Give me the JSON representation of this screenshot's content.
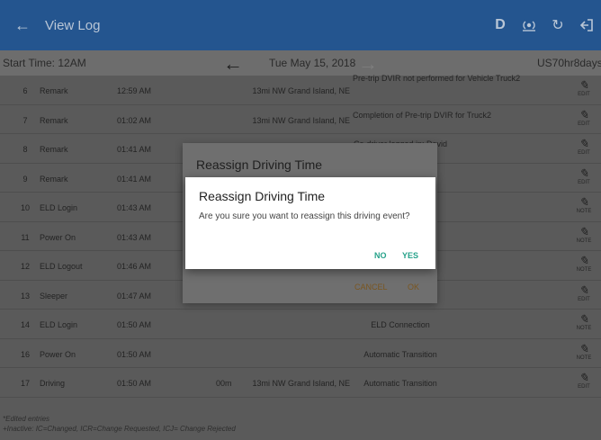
{
  "appbar": {
    "title": "View Log",
    "driver_letter": "D",
    "back_icon": "arrow-left-icon",
    "refresh_icon": "refresh-icon",
    "exit_icon": "logout-icon",
    "connection_icon": "eld-connection-icon"
  },
  "subbar": {
    "start_time": "Start Time: 12AM",
    "date": "Tue May 15, 2018",
    "ruleset": "US70hr8days"
  },
  "rows": [
    {
      "num": "6",
      "type": "Remark",
      "time": "12:59 AM",
      "dist": "",
      "location": "13mi NW Grand Island, NE",
      "note": "Pre-trip DVIR not performed for Vehicle Truck2",
      "action": "EDIT"
    },
    {
      "num": "7",
      "type": "Remark",
      "time": "01:02 AM",
      "dist": "",
      "location": "13mi NW Grand Island, NE",
      "note": "Completion of Pre-trip DVIR for Truck2",
      "action": "EDIT"
    },
    {
      "num": "8",
      "type": "Remark",
      "time": "01:41 AM",
      "dist": "",
      "location": "",
      "note": "Co-driver logged in: David",
      "action": "EDIT"
    },
    {
      "num": "9",
      "type": "Remark",
      "time": "01:41 AM",
      "dist": "",
      "location": "",
      "note": "",
      "action": "EDIT"
    },
    {
      "num": "10",
      "type": "ELD Login",
      "time": "01:43 AM",
      "dist": "",
      "location": "",
      "note": "",
      "action": "NOTE"
    },
    {
      "num": "11",
      "type": "Power On",
      "time": "01:43 AM",
      "dist": "",
      "location": "",
      "note": "",
      "action": "NOTE"
    },
    {
      "num": "12",
      "type": "ELD Logout",
      "time": "01:46 AM",
      "dist": "",
      "location": "",
      "note": "",
      "action": "NOTE"
    },
    {
      "num": "13",
      "type": "Sleeper",
      "time": "01:47 AM",
      "dist": "",
      "location": "",
      "note": "",
      "action": "EDIT"
    },
    {
      "num": "14",
      "type": "ELD Login",
      "time": "01:50 AM",
      "dist": "",
      "location": "",
      "note": "ELD Connection",
      "action": "NOTE"
    },
    {
      "num": "16",
      "type": "Power On",
      "time": "01:50 AM",
      "dist": "",
      "location": "",
      "note": "Automatic Transition",
      "action": "NOTE"
    },
    {
      "num": "17",
      "type": "Driving",
      "time": "01:50 AM",
      "dist": "00m",
      "location": "13mi NW Grand Island, NE",
      "note": "Automatic Transition",
      "action": "EDIT"
    }
  ],
  "legend": {
    "line1": "*Edited entries",
    "line2": "+Inactive: IC=Changed, ICR=Change Requested, ICJ= Change Rejected"
  },
  "dialog_back": {
    "title": "Reassign Driving Time",
    "cancel": "CANCEL",
    "ok": "OK"
  },
  "dialog": {
    "title": "Reassign Driving Time",
    "message": "Are you sure you want to reassign this driving event?",
    "no": "NO",
    "yes": "YES"
  },
  "colors": {
    "appbar": "#24558f",
    "accent": "#26a28a",
    "scrim_background": "#5a5a5a"
  }
}
